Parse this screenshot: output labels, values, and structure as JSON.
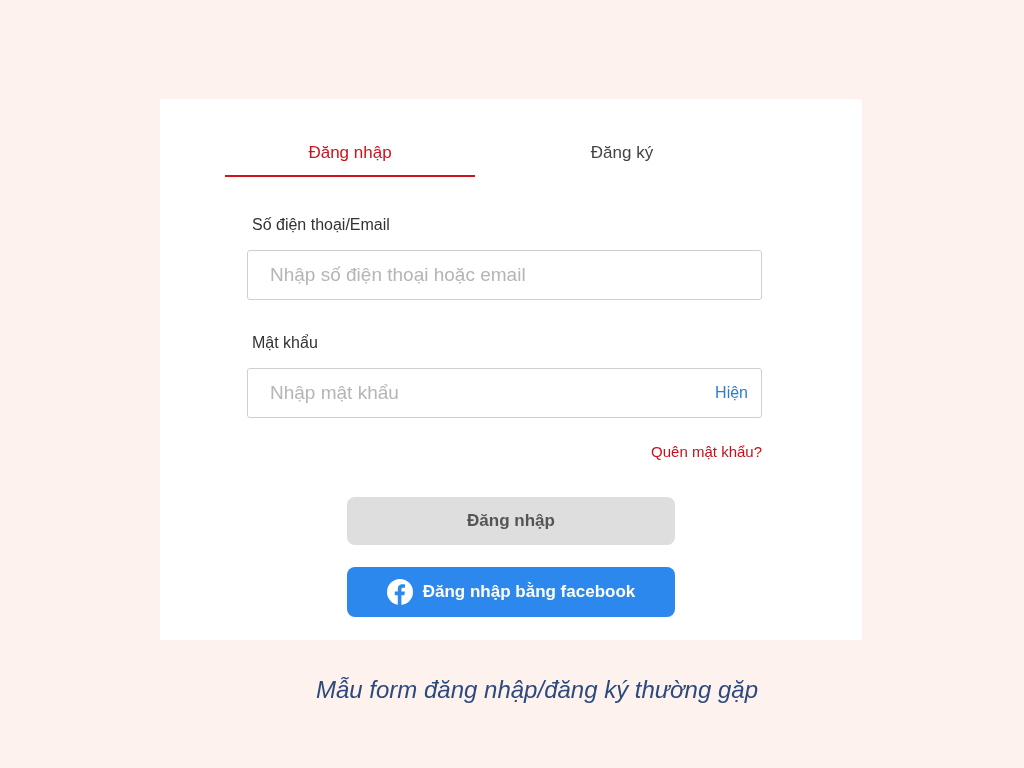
{
  "tabs": [
    {
      "label": "Đăng nhập",
      "selected": true
    },
    {
      "label": "Đăng ký",
      "selected": false
    }
  ],
  "fields": [
    {
      "label": "Số điện thoại/Email",
      "placeholder": "Nhập số điện thoại hoặc email"
    },
    {
      "label": "Mật khẩu",
      "placeholder": "Nhập mật khẩu",
      "toggle": "Hiện"
    }
  ],
  "forgot_link": "Quên mật khẩu?",
  "buttons": [
    {
      "kind": "primary",
      "label": "Đăng nhập"
    },
    {
      "kind": "facebook",
      "label": "Đăng nhập bằng facebook"
    }
  ],
  "caption": "Mẫu form đăng nhập/đăng ký thường gặp"
}
